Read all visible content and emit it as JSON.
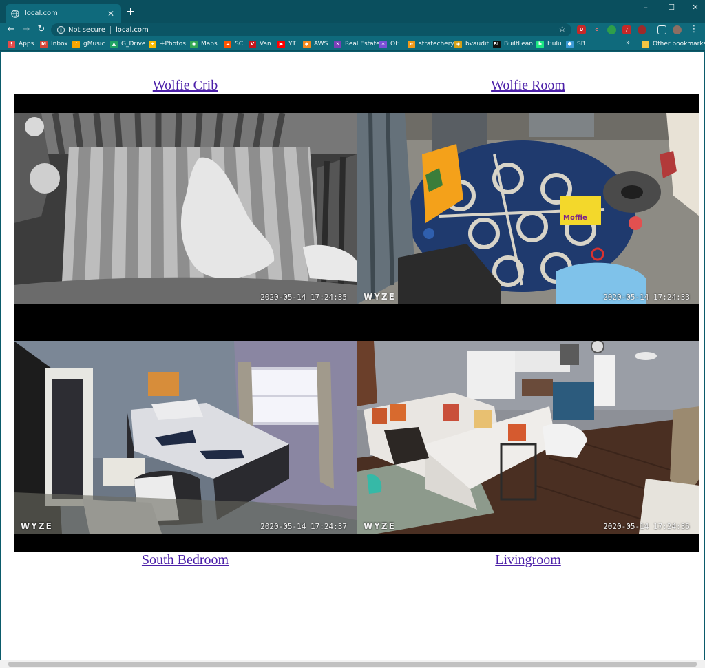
{
  "browser": {
    "tab_title": "local.com",
    "new_tab": "+",
    "security": "Not secure",
    "url": "local.com",
    "window_controls": {
      "minimize": "–",
      "maximize": "☐",
      "close": "✕"
    },
    "bookmarks": [
      {
        "label": "Apps",
        "color": "#e24b4b",
        "glyph": "⋮"
      },
      {
        "label": "Inbox",
        "color": "#d44638",
        "glyph": "M"
      },
      {
        "label": "gMusic",
        "color": "#f7a600",
        "glyph": "♪"
      },
      {
        "label": "G_Drive",
        "color": "#1fa463",
        "glyph": "▲"
      },
      {
        "label": "+Photos",
        "color": "#fbbc04",
        "glyph": "✦"
      },
      {
        "label": "Maps",
        "color": "#34a853",
        "glyph": "◉"
      },
      {
        "label": "SC",
        "color": "#ff5500",
        "glyph": "☁"
      },
      {
        "label": "Van",
        "color": "#c4161c",
        "glyph": "V"
      },
      {
        "label": "YT",
        "color": "#ff0000",
        "glyph": "▶"
      },
      {
        "label": "AWS",
        "color": "#f68a1e",
        "glyph": "◆"
      },
      {
        "label": "Real Estate",
        "color": "#7b3fb8",
        "glyph": "✕"
      },
      {
        "label": "OH",
        "color": "#7a4fd6",
        "glyph": "✶"
      },
      {
        "label": "stratechery",
        "color": "#f19a1a",
        "glyph": "e"
      },
      {
        "label": "bvaudit",
        "color": "#d4a017",
        "glyph": "◈"
      },
      {
        "label": "BuiltLean",
        "color": "#111111",
        "glyph": "BL"
      },
      {
        "label": "Hulu",
        "color": "#1ce783",
        "glyph": "h"
      },
      {
        "label": "SB",
        "color": "#3d9bd6",
        "glyph": "⬢"
      }
    ],
    "bookmarks_more": "»",
    "other_bookmarks": "Other bookmarks"
  },
  "cameras": [
    {
      "name": "Wolfie Crib",
      "timestamp": "2020-05-14  17:24:35",
      "brand": ""
    },
    {
      "name": "Wolfie Room",
      "timestamp": "2020-05-14  17:24:33",
      "brand": "WYZE"
    },
    {
      "name": "South Bedroom",
      "timestamp": "2020-05-14  17:24:37",
      "brand": "WYZE"
    },
    {
      "name": "Livingroom",
      "timestamp": "2020-05-14  17:24:35",
      "brand": "WYZE"
    }
  ],
  "book_text": "Moffie"
}
